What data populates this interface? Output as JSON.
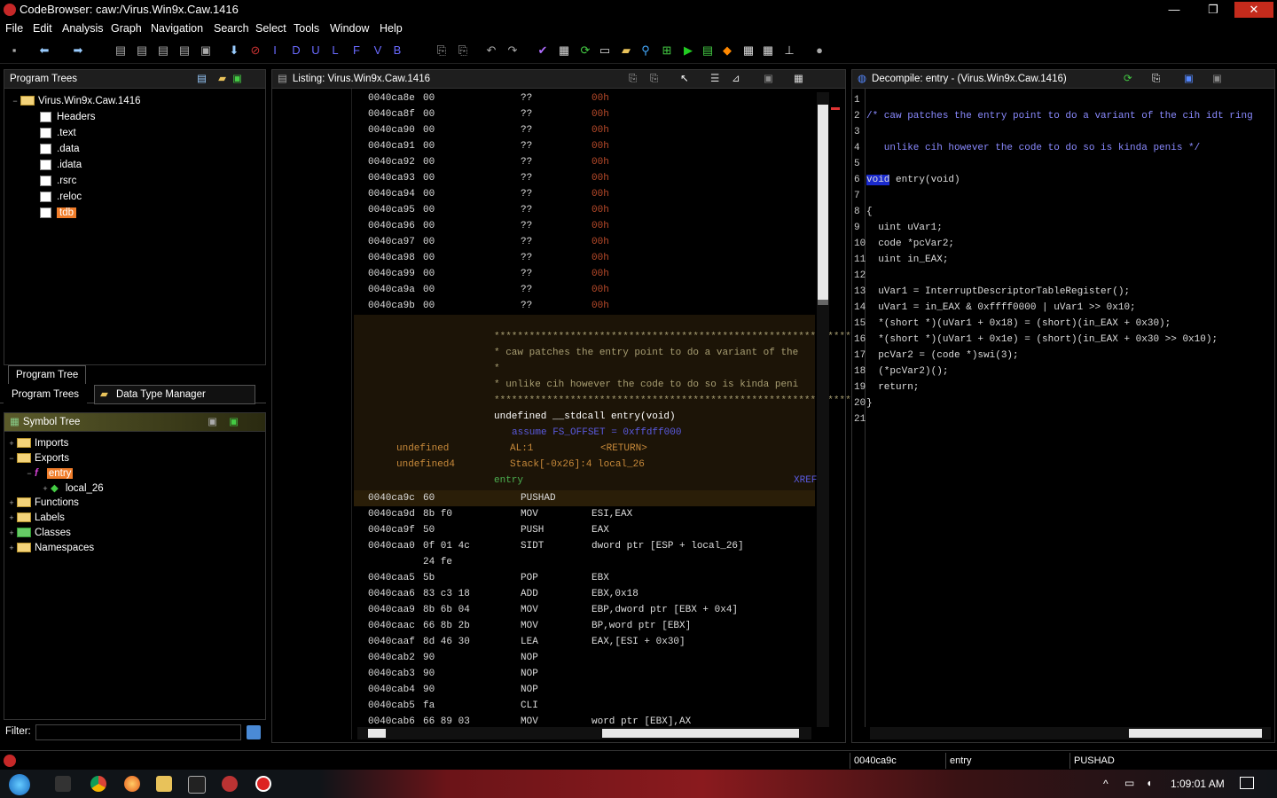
{
  "window": {
    "title": "CodeBrowser: caw:/Virus.Win9x.Caw.1416",
    "minimize": "—",
    "restore": "❐",
    "close": "✕"
  },
  "menu": [
    "File",
    "Edit",
    "Analysis",
    "Graph",
    "Navigation",
    "Search",
    "Select",
    "Tools",
    "Window",
    "Help"
  ],
  "toolbar": {
    "letters": [
      "I",
      "D",
      "U",
      "L",
      "F",
      "V",
      "B"
    ],
    "icons": [
      "save-icon",
      "back-arrow-icon",
      "forward-arrow-icon",
      "bookmark-icon",
      "down-arrow-icon",
      "stop-icon",
      "undo-icon",
      "redo-icon",
      "check-icon",
      "run-icon"
    ]
  },
  "program_trees": {
    "title": "Program Trees",
    "root": "Virus.Win9x.Caw.1416",
    "items": [
      "Headers",
      ".text",
      ".data",
      ".idata",
      ".rsrc",
      ".reloc",
      "tdb"
    ],
    "selected": "tdb",
    "tab_bottom": "Program Tree",
    "tabs": [
      "Program Trees",
      "Data Type Manager"
    ]
  },
  "symbol_tree": {
    "title": "Symbol Tree",
    "items": [
      {
        "label": "Imports",
        "level": 0,
        "fold": "+"
      },
      {
        "label": "Exports",
        "level": 0,
        "fold": "−"
      },
      {
        "label": "entry",
        "level": 1,
        "fold": "−"
      },
      {
        "label": "local_26",
        "level": 2,
        "fold": "+"
      },
      {
        "label": "Functions",
        "level": 0,
        "fold": "+"
      },
      {
        "label": "Labels",
        "level": 0,
        "fold": "+"
      },
      {
        "label": "Classes",
        "level": 0,
        "fold": "+"
      },
      {
        "label": "Namespaces",
        "level": 0,
        "fold": "+"
      }
    ],
    "filter_label": "Filter:",
    "filter_value": ""
  },
  "listing": {
    "title": "Listing:  Virus.Win9x.Caw.1416",
    "data_rows": [
      [
        "0040ca8e",
        "00",
        "??",
        "00h"
      ],
      [
        "0040ca8f",
        "00",
        "??",
        "00h"
      ],
      [
        "0040ca90",
        "00",
        "??",
        "00h"
      ],
      [
        "0040ca91",
        "00",
        "??",
        "00h"
      ],
      [
        "0040ca92",
        "00",
        "??",
        "00h"
      ],
      [
        "0040ca93",
        "00",
        "??",
        "00h"
      ],
      [
        "0040ca94",
        "00",
        "??",
        "00h"
      ],
      [
        "0040ca95",
        "00",
        "??",
        "00h"
      ],
      [
        "0040ca96",
        "00",
        "??",
        "00h"
      ],
      [
        "0040ca97",
        "00",
        "??",
        "00h"
      ],
      [
        "0040ca98",
        "00",
        "??",
        "00h"
      ],
      [
        "0040ca99",
        "00",
        "??",
        "00h"
      ],
      [
        "0040ca9a",
        "00",
        "??",
        "00h"
      ],
      [
        "0040ca9b",
        "00",
        "??",
        "00h"
      ]
    ],
    "header_block": {
      "stars": "*************************************************************",
      "c1": "* caw patches the entry point to do a variant of the",
      "c2": "*",
      "c3": "* unlike cih however the code to do so is kinda peni",
      "sig": "undefined __stdcall entry(void)",
      "assume": "assume FS_OFFSET = 0xffdff000",
      "r1": [
        "undefined",
        "AL:1",
        "<RETURN>"
      ],
      "r2": [
        "undefined4",
        "Stack[-0x26]:4 local_26"
      ],
      "label": "entry",
      "xref": "XREF"
    },
    "code_rows": [
      [
        "0040ca9c",
        "60",
        "PUSHAD",
        ""
      ],
      [
        "0040ca9d",
        "8b f0",
        "MOV",
        "ESI,EAX"
      ],
      [
        "0040ca9f",
        "50",
        "PUSH",
        "EAX"
      ],
      [
        "0040caa0",
        "0f 01 4c",
        "SIDT",
        "dword ptr [ESP + local_26]"
      ],
      [
        "",
        "24 fe",
        "",
        ""
      ],
      [
        "0040caa5",
        "5b",
        "POP",
        "EBX"
      ],
      [
        "0040caa6",
        "83 c3 18",
        "ADD",
        "EBX,0x18"
      ],
      [
        "0040caa9",
        "8b 6b 04",
        "MOV",
        "EBP,dword ptr [EBX + 0x4]"
      ],
      [
        "0040caac",
        "66 8b 2b",
        "MOV",
        "BP,word ptr [EBX]"
      ],
      [
        "0040caaf",
        "8d 46 30",
        "LEA",
        "EAX,[ESI + 0x30]"
      ],
      [
        "0040cab2",
        "90",
        "NOP",
        ""
      ],
      [
        "0040cab3",
        "90",
        "NOP",
        ""
      ],
      [
        "0040cab4",
        "90",
        "NOP",
        ""
      ],
      [
        "0040cab5",
        "fa",
        "CLI",
        ""
      ],
      [
        "0040cab6",
        "66 89 03",
        "MOV",
        "word ptr [EBX],AX"
      ]
    ]
  },
  "decompile": {
    "title": "Decompile: entry -  (Virus.Win9x.Caw.1416)",
    "lines": [
      "",
      "/* caw patches the entry point to do a variant of the cih idt ring",
      "",
      "   unlike cih however the code to do so is kinda penis */",
      "",
      "void entry(void)",
      "",
      "{",
      "  uint uVar1;",
      "  code *pcVar2;",
      "  uint in_EAX;",
      "",
      "  uVar1 = InterruptDescriptorTableRegister();",
      "  uVar1 = in_EAX & 0xffff0000 | uVar1 >> 0x10;",
      "  *(short *)(uVar1 + 0x18) = (short)(in_EAX + 0x30);",
      "  *(short *)(uVar1 + 0x1e) = (short)(in_EAX + 0x30 >> 0x10);",
      "  pcVar2 = (code *)swi(3);",
      "  (*pcVar2)();",
      "  return;",
      "}",
      ""
    ]
  },
  "status": {
    "address": "0040ca9c",
    "function": "entry",
    "instruction": "PUSHAD"
  },
  "taskbar": {
    "time": "1:09:01 AM"
  },
  "colors": {
    "accent_selected": "#f07d2a",
    "header_bg": "#1c1407",
    "blue_operand": "#5a5adf"
  }
}
